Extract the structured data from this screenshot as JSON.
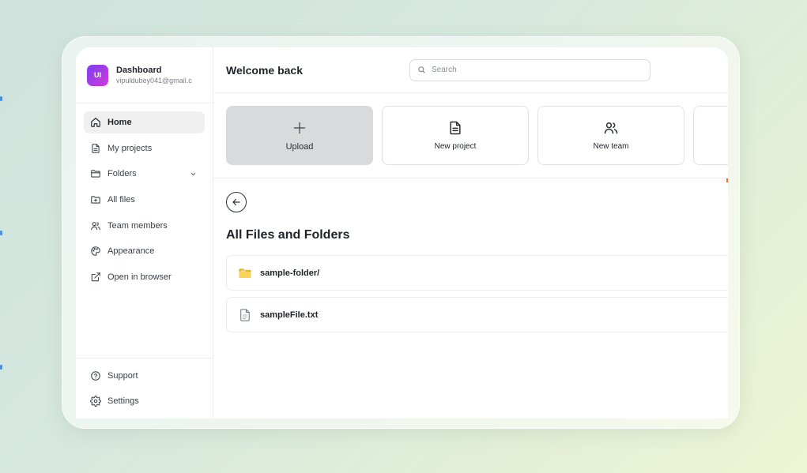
{
  "brand": {
    "logo_text": "UI",
    "title": "Dashboard",
    "email": "vipuldubey041@gmail.c"
  },
  "sidebar": {
    "items": [
      {
        "label": "Home",
        "icon": "home-icon",
        "active": true
      },
      {
        "label": "My projects",
        "icon": "document-icon"
      },
      {
        "label": "Folders",
        "icon": "folder-icon",
        "expandable": true
      },
      {
        "label": "All files",
        "icon": "folder-plus-icon"
      },
      {
        "label": "Team members",
        "icon": "users-icon"
      },
      {
        "label": "Appearance",
        "icon": "palette-icon"
      },
      {
        "label": "Open in browser",
        "icon": "external-link-icon"
      }
    ],
    "bottom_items": [
      {
        "label": "Support",
        "icon": "help-circle-icon"
      },
      {
        "label": "Settings",
        "icon": "gear-icon"
      }
    ]
  },
  "header": {
    "title": "Welcome back",
    "search_placeholder": "Search"
  },
  "actions": [
    {
      "label": "Upload",
      "icon": "plus-icon"
    },
    {
      "label": "New project",
      "icon": "document-icon"
    },
    {
      "label": "New team",
      "icon": "users-icon"
    }
  ],
  "content": {
    "section_title": "All Files and Folders",
    "files": [
      {
        "name": "sample-folder/",
        "type": "folder",
        "icon": "folder-icon"
      },
      {
        "name": "sampleFile.txt",
        "type": "file",
        "icon": "file-icon"
      }
    ]
  },
  "colors": {
    "brand_gradient_start": "#7b3ff2",
    "brand_gradient_end": "#d23ad6",
    "folder_yellow": "#f2c233",
    "active_bg": "#f0f0f1"
  }
}
